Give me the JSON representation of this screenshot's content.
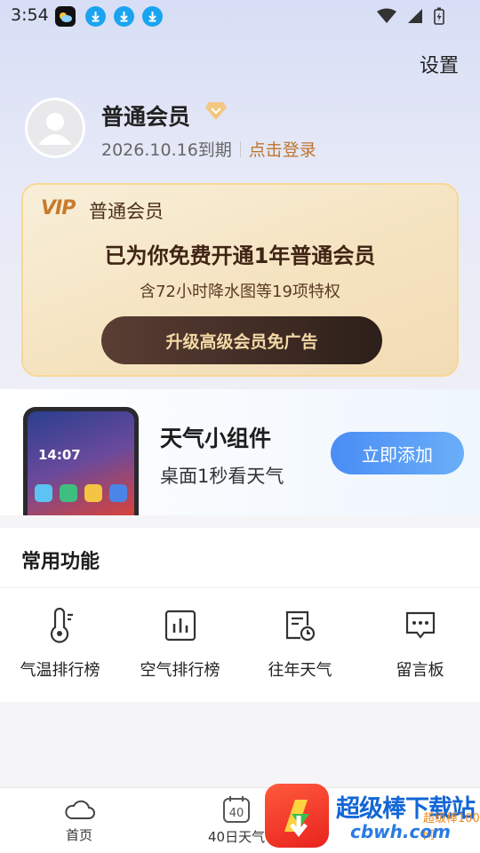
{
  "status_bar": {
    "time": "3:54",
    "icons": [
      "weather-app-icon",
      "download-icon",
      "download-icon",
      "download-icon"
    ],
    "right_icons": [
      "wifi-icon",
      "signal-icon",
      "battery-icon"
    ]
  },
  "header": {
    "settings_label": "设置"
  },
  "profile": {
    "member_name": "普通会员",
    "expire_date": "2026.10.16到期",
    "login_link": "点击登录"
  },
  "vip_card": {
    "logo": "VIP",
    "title": "普通会员",
    "headline": "已为你免费开通1年普通会员",
    "subtext": "含72小时降水图等19项特权",
    "button_label": "升级高级会员免广告",
    "accent_color": "#c77b2e"
  },
  "widget_promo": {
    "phone_time": "14:07",
    "title": "天气小组件",
    "subtitle": "桌面1秒看天气",
    "button_label": "立即添加",
    "button_color": "#4a8df6"
  },
  "functions": {
    "header": "常用功能",
    "items": [
      {
        "label": "气温排行榜",
        "icon": "thermometer-icon"
      },
      {
        "label": "空气排行榜",
        "icon": "bar-chart-icon"
      },
      {
        "label": "往年天气",
        "icon": "history-calendar-icon"
      },
      {
        "label": "留言板",
        "icon": "message-board-icon"
      }
    ]
  },
  "bottom_nav": {
    "items": [
      {
        "label": "首页",
        "icon": "cloud-icon"
      },
      {
        "label": "40日天气",
        "icon": "calendar-40-icon",
        "badge": "40"
      }
    ]
  },
  "watermark": {
    "text": "超级棒下载站",
    "url": "cbwh.com",
    "sub": "超级棒100网"
  }
}
